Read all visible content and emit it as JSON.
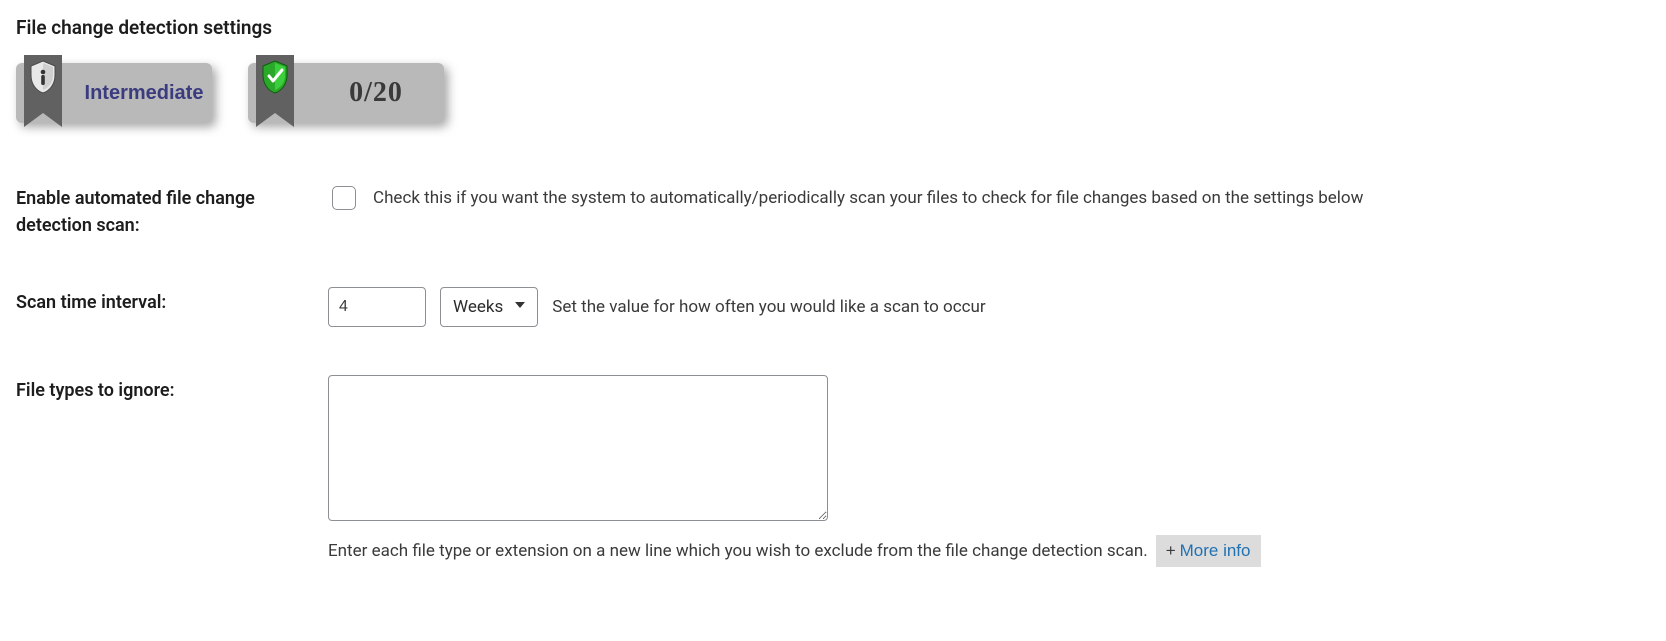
{
  "section_title": "File change detection settings",
  "badges": {
    "intermediate_label": "Intermediate",
    "score_label": "0/20"
  },
  "enable_scan": {
    "label": "Enable automated file change detection scan:",
    "checked": false,
    "description": "Check this if you want the system to automatically/periodically scan your files to check for file changes based on the settings below"
  },
  "scan_interval": {
    "label": "Scan time interval:",
    "value": "4",
    "unit_selected": "Weeks",
    "description": "Set the value for how often you would like a scan to occur"
  },
  "ignore_types": {
    "label": "File types to ignore:",
    "value": "",
    "helper": "Enter each file type or extension on a new line which you wish to exclude from the file change detection scan.",
    "more_info_label": "More info"
  }
}
